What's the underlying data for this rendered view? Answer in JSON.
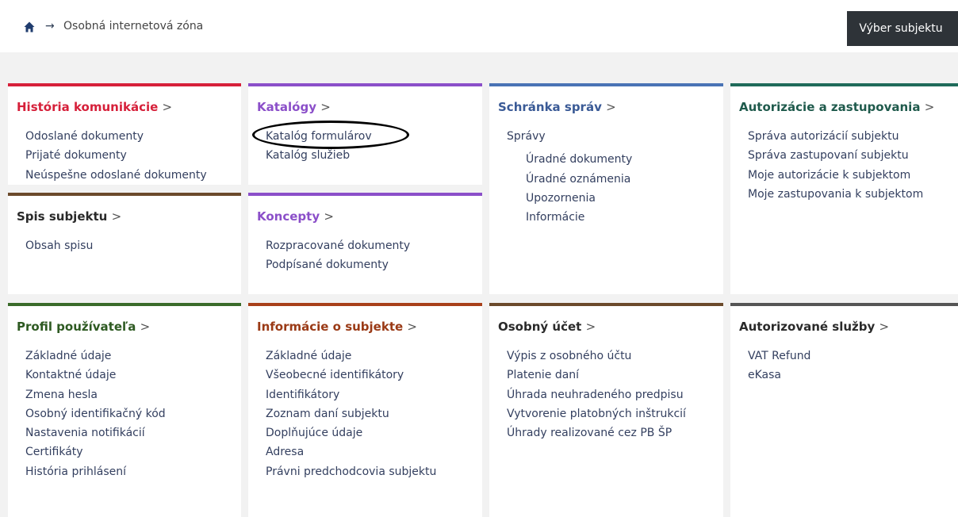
{
  "breadcrumb": {
    "current": "Osobná internetová zóna",
    "separator": "→"
  },
  "header": {
    "subject_button": "Výber subjektu"
  },
  "cards": {
    "historia": {
      "title": "História komunikácie",
      "color": "#d6203a",
      "items": [
        "Odoslané dokumenty",
        "Prijaté dokumenty",
        "Neúspešne odoslané dokumenty"
      ]
    },
    "katalogy": {
      "title": "Katalógy",
      "color": "#8b4fc9",
      "items": [
        "Katalóg formulárov",
        "Katalóg služieb"
      ]
    },
    "schranka": {
      "title": "Schránka správ",
      "color": "#4a73b5",
      "items": [
        "Správy"
      ],
      "sub_items": [
        "Úradné dokumenty",
        "Úradné oznámenia",
        "Upozornenia",
        "Informácie"
      ]
    },
    "autorizacie": {
      "title": "Autorizácie a zastupovania",
      "color": "#1f6b5a",
      "items": [
        "Správa autorizácií subjektu",
        "Správa zastupovaní subjektu",
        "Moje autorizácie k subjektom",
        "Moje zastupovania k subjektom"
      ]
    },
    "spis": {
      "title": "Spis subjektu",
      "color": "#6b4a2b",
      "items": [
        "Obsah spisu"
      ]
    },
    "koncepty": {
      "title": "Koncepty",
      "color": "#8b4fc9",
      "items": [
        "Rozpracované dokumenty",
        "Podpísané dokumenty"
      ]
    },
    "profil": {
      "title": "Profil používateľa",
      "color": "#3a6b2a",
      "items": [
        "Základné údaje",
        "Kontaktné údaje",
        "Zmena hesla",
        "Osobný identifikačný kód",
        "Nastavenia notifikácií",
        "Certifikáty",
        "História prihlásení"
      ]
    },
    "informacie": {
      "title": "Informácie o subjekte",
      "color": "#a8401a",
      "items": [
        "Základné údaje",
        "Všeobecné identifikátory",
        "Identifikátory",
        "Zoznam daní subjektu",
        "Doplňujúce údaje",
        "Adresa",
        "Právni predchodcovia subjektu"
      ]
    },
    "ucet": {
      "title": "Osobný účet",
      "color": "#6b4a2b",
      "items": [
        "Výpis z osobného účtu",
        "Platenie daní",
        "Úhrada neuhradeného predpisu",
        "Vytvorenie platobných inštrukcií",
        "Úhrady realizované cez PB ŠP"
      ]
    },
    "sluzby": {
      "title": "Autorizované služby",
      "color": "#555555",
      "items": [
        "VAT Refund",
        "eKasa"
      ]
    }
  }
}
